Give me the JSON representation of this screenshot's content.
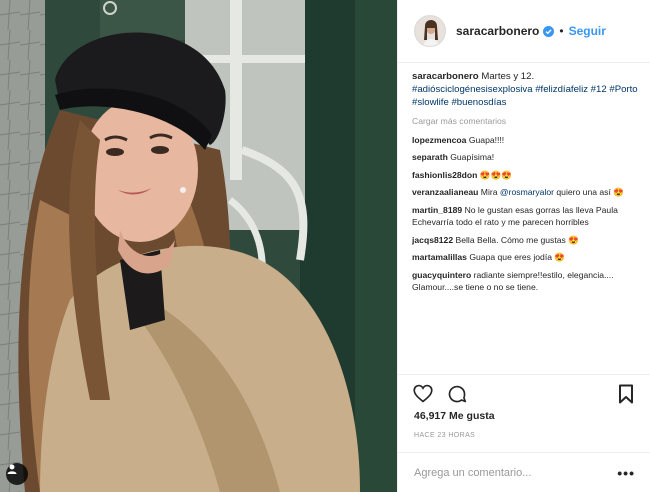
{
  "post": {
    "image_alt": "sara carbonero photo",
    "tag_icon": "person-tag-icon"
  },
  "header": {
    "username": "saracarbonero",
    "verified_icon": "verified-badge-icon",
    "separator": "•",
    "follow_label": "Seguir"
  },
  "caption": {
    "username": "saracarbonero",
    "text": "Martes y 12.",
    "hashtags": [
      "#adiósciclogénesisexplosiva",
      "#felizdíafeliz",
      "#12",
      "#Porto",
      "#slowlife",
      "#buenosdías"
    ]
  },
  "load_more_label": "Cargar más comentarios",
  "comments": [
    {
      "user": "lopezmencoa",
      "text": "Guapa!!!!",
      "mention": ""
    },
    {
      "user": "separath",
      "text": "Guapísima!",
      "mention": ""
    },
    {
      "user": "fashionlis28don",
      "text": "😍😍😍",
      "mention": ""
    },
    {
      "user": "veranzaalianeau",
      "text": "Mira",
      "mention": "@rosmaryalor",
      "after": "quiero una así 😍"
    },
    {
      "user": "martin_8189",
      "text": "No le gustan esas gorras las lleva Paula Echevarría todo el rato y me parecen horribles",
      "mention": ""
    },
    {
      "user": "jacqs8122",
      "text": "Bella Bella. Cómo me gustas 😍",
      "mention": ""
    },
    {
      "user": "martamalillas",
      "text": "Guapa que eres jodía 😍",
      "mention": ""
    },
    {
      "user": "guacyquintero",
      "text": "radiante siempre!!estilo, elegancia.... Glamour....se tiene o no se tiene.",
      "mention": ""
    }
  ],
  "actions": {
    "like_icon": "heart-icon",
    "comment_icon": "comment-icon",
    "save_icon": "bookmark-icon"
  },
  "likes_label": "46,917 Me gusta",
  "timestamp": "HACE 23 HORAS",
  "add_comment_placeholder": "Agrega un comentario...",
  "more_options_label": "•••",
  "colors": {
    "link_blue": "#3897f0",
    "hashtag_blue": "#003569",
    "muted_gray": "#999999",
    "text": "#262626",
    "border": "#efefef"
  }
}
